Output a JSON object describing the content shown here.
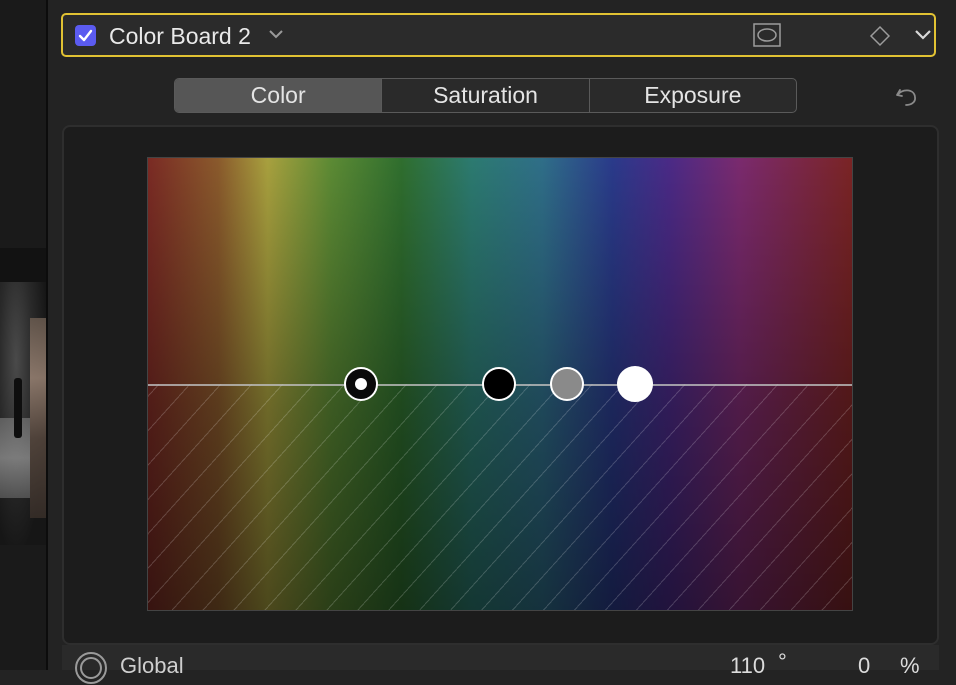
{
  "header": {
    "effect_name": "Color Board 2",
    "enabled": true,
    "icons": [
      "checkbox-checked-icon",
      "chevron-down-icon",
      "mask-icon",
      "keyframe-diamond-icon",
      "chevron-down-icon"
    ]
  },
  "tabs": [
    {
      "label": "Color",
      "active": true
    },
    {
      "label": "Saturation",
      "active": false
    },
    {
      "label": "Exposure",
      "active": false
    }
  ],
  "board": {
    "pucks": [
      "master",
      "shadows",
      "midtones",
      "highlights"
    ]
  },
  "readout": {
    "global_label": "Global",
    "angle_value": "110",
    "angle_unit": "°",
    "percent_value": "0",
    "percent_unit": "%"
  },
  "colors": {
    "accent_border": "#e1c233",
    "checkbox": "#5b5bf0",
    "active_tab": "#565656"
  }
}
